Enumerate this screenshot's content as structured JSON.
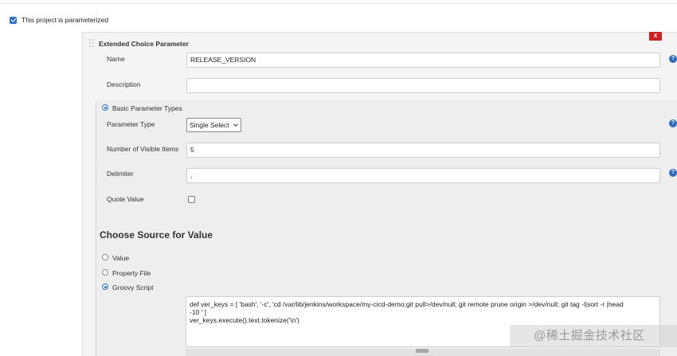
{
  "parameterized": {
    "label": "This project is parameterized",
    "checked": true
  },
  "parameter_block": {
    "title": "Extended Choice Parameter",
    "delete_label": "X",
    "name": {
      "label": "Name",
      "value": "RELEASE_VERSION"
    },
    "description": {
      "label": "Description",
      "value": ""
    },
    "basic_types": {
      "label": "Basic Parameter Types",
      "selected": true
    },
    "parameter_type": {
      "label": "Parameter Type",
      "value": "Single Select"
    },
    "visible_items": {
      "label": "Number of Visible Items",
      "value": "5"
    },
    "delimiter": {
      "label": "Delimiter",
      "value": ","
    },
    "quote_value": {
      "label": "Quote Value",
      "checked": false
    },
    "choose_source": {
      "title": "Choose Source for Value",
      "options": [
        {
          "label": "Value",
          "selected": false
        },
        {
          "label": "Property File",
          "selected": false
        },
        {
          "label": "Groovy Script",
          "selected": true
        }
      ]
    },
    "groovy_script": {
      "lines": [
        "def ver_keys = [ 'bash', '-c', 'cd /var/lib/jenkins/workspace/my-cicd-demo;git pull>/dev/null; git remote prune origin >/dev/null; git tag -l|sort -r |head",
        "-10 ' ]",
        "ver_keys.execute().text.tokenize('\\n')"
      ]
    },
    "help_icon": "?"
  },
  "watermark": "@稀土掘金技术社区",
  "colors": {
    "accent": "#2b71c8",
    "delete": "#cc2222",
    "help": "#2f6bbd"
  }
}
